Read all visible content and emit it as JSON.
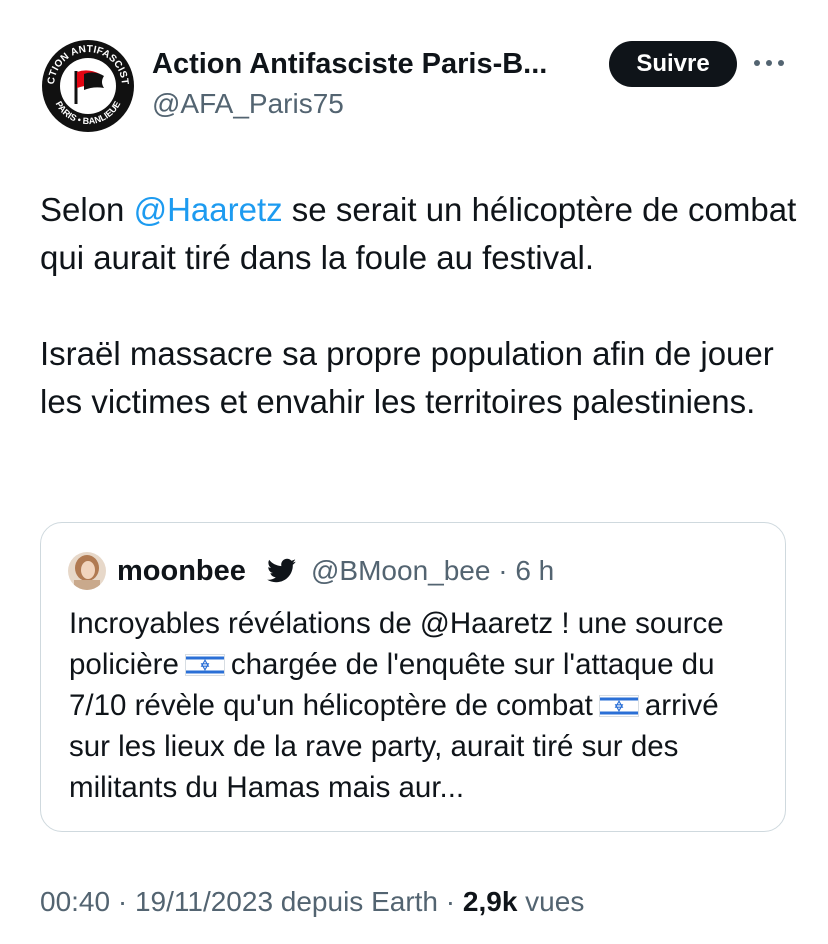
{
  "author": {
    "display_name": "Action Antifasciste Paris-B...",
    "handle": "@AFA_Paris75",
    "avatar_icon": "antifa-logo-avatar",
    "avatar_text_top": "ACTION ANTIFASCISTE",
    "avatar_text_bottom": "PARIS • BANLIEUE"
  },
  "follow_button": {
    "label": "Suivre"
  },
  "more_icon": {
    "glyph": "···"
  },
  "tweet": {
    "p1_before": "Selon ",
    "p1_mention": "@Haaretz",
    "p1_after": " se serait un hélicoptère de combat qui aurait tiré dans la foule au festival.",
    "p2": "Israël massacre sa propre population afin de jouer les victimes et envahir les territoires palestiniens."
  },
  "quote": {
    "name": "moonbee",
    "handle_time": "@BMoon_bee · 6 h",
    "text_a": "Incroyables révélations de @Haaretz ! une source policière",
    "text_b": "chargée de l'enquête sur l'attaque du 7/10 révèle qu'un hélicoptère de combat",
    "text_c": "arrivé sur les lieux de la rave party, aurait tiré sur des militants du Hamas mais aur..."
  },
  "meta": {
    "prefix": "00:40 · 19/11/2023 depuis Earth · ",
    "views_count": "2,9k",
    "views_label": " vues"
  },
  "colors": {
    "accent": "#1d9bf0",
    "text": "#0f1419",
    "secondary": "#536471",
    "border": "#cfd9de",
    "antifa_red": "#e30613"
  }
}
